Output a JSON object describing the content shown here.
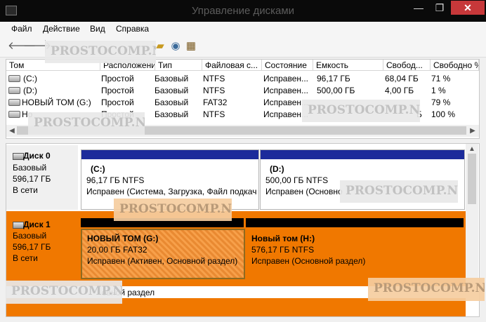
{
  "window": {
    "title": "Управление дисками",
    "minimize": "—",
    "maximize": "❐",
    "close": "✕"
  },
  "menu": [
    "Файл",
    "Действие",
    "Вид",
    "Справка"
  ],
  "watermark": "PROSTOCOMP.NET",
  "columns": [
    "Том",
    "Расположение",
    "Тип",
    "Файловая с...",
    "Состояние",
    "Емкость",
    "Свобод...",
    "Свободно %"
  ],
  "volumes": [
    {
      "name": "(C:)",
      "layout": "Простой",
      "type": "Базовый",
      "fs": "NTFS",
      "status": "Исправен...",
      "capacity": "96,17 ГБ",
      "free": "68,04 ГБ",
      "free_pct": "71 %"
    },
    {
      "name": "(D:)",
      "layout": "Простой",
      "type": "Базовый",
      "fs": "NTFS",
      "status": "Исправен...",
      "capacity": "500,00 ГБ",
      "free": "4,00 ГБ",
      "free_pct": "1 %"
    },
    {
      "name": "НОВЫЙ ТОМ (G:)",
      "layout": "Простой",
      "type": "Базовый",
      "fs": "FAT32",
      "status": "Исправен...",
      "capacity": "",
      "free": "",
      "free_pct": "79 %"
    },
    {
      "name": "Но",
      "layout": "Простой",
      "type": "Базовый",
      "fs": "NTFS",
      "status": "Исправен...",
      "capacity": "",
      "free": "Б",
      "free_pct": "100 %"
    }
  ],
  "disks": [
    {
      "name": "Диск 0",
      "type": "Базовый",
      "size": "596,17 ГБ",
      "status": "В сети",
      "partitions": [
        {
          "name": "(C:)",
          "size_fs": "96,17 ГБ NTFS",
          "status": "Исправен (Система, Загрузка, Файл подкач"
        },
        {
          "name": "(D:)",
          "size_fs": "500,00 ГБ NTFS",
          "status": "Исправен (Основно"
        }
      ]
    },
    {
      "name": "Диск 1",
      "type": "Базовый",
      "size": "596,17 ГБ",
      "status": "В сети",
      "partitions": [
        {
          "name": "НОВЫЙ ТОМ  (G:)",
          "size_fs": "20,00 ГБ FAT32",
          "status": "Исправен (Активен, Основной раздел)"
        },
        {
          "name": "Новый том  (H:)",
          "size_fs": "576,17 ГБ NTFS",
          "status": "Исправен (Основной раздел)"
        }
      ]
    }
  ],
  "legend": {
    "primary": "овной раздел"
  },
  "colors": {
    "primary_partition": "#1c2b9b",
    "selected": "#f07800",
    "title_bar": "#0a0a0a"
  },
  "icons": [
    "back-arrow-icon",
    "forward-arrow-icon",
    "folder-icon",
    "search-icon",
    "properties-icon"
  ]
}
